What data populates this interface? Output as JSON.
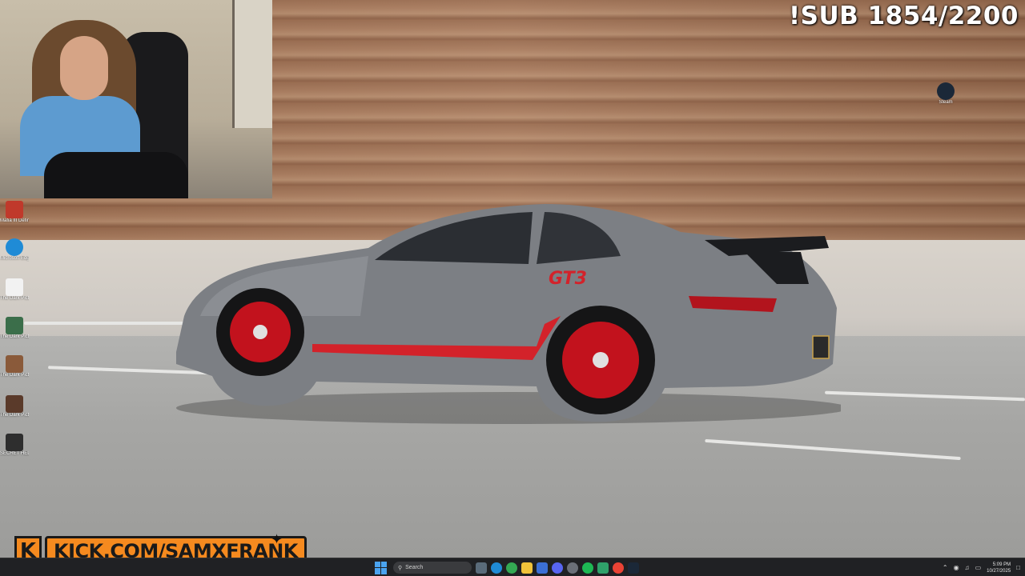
{
  "overlay": {
    "sub_goal": "!SUB 1854/2200",
    "kick_url": "KICK.COM/SAMXFRANK",
    "kick_logo_letter": "K"
  },
  "desktop": {
    "icons": [
      {
        "label": "Mafia III Definiti...",
        "icon": "mafia-icon",
        "color": "#c0392b"
      },
      {
        "label": "Microsoft Edge",
        "icon": "edge-icon",
        "color": "#1f8bd6"
      },
      {
        "label": "The Dark Pictures An...",
        "icon": "document-icon",
        "color": "#f2f2f2"
      },
      {
        "label": "The Dark Pictures An...",
        "icon": "game-icon",
        "color": "#3b6e4a"
      },
      {
        "label": "The Dark Pictures A...",
        "icon": "game-icon",
        "color": "#8a5a3a"
      },
      {
        "label": "The Dark Pictures A...",
        "icon": "game-icon",
        "color": "#5a3a2a"
      },
      {
        "label": "SECRET HELL 2",
        "icon": "game-icon",
        "color": "#2e2e2e"
      }
    ],
    "steam_icon_label": "Steam"
  },
  "wallpaper": {
    "car_badge": "GT3"
  },
  "taskbar": {
    "search_placeholder": "Search",
    "apps": [
      "start-icon",
      "search-icon",
      "widgets-icon",
      "edge-icon",
      "chrome-icon",
      "file-explorer-icon",
      "store-icon",
      "discord-icon",
      "settings-icon",
      "spotify-icon",
      "app-icon",
      "chrome-icon",
      "steam-icon"
    ],
    "clock_time": "5:09 PM",
    "clock_date": "10/27/2025"
  },
  "colors": {
    "kick_orange": "#f58a1f",
    "taskbar_bg": "#202124",
    "car_accent_red": "#d3222a"
  }
}
